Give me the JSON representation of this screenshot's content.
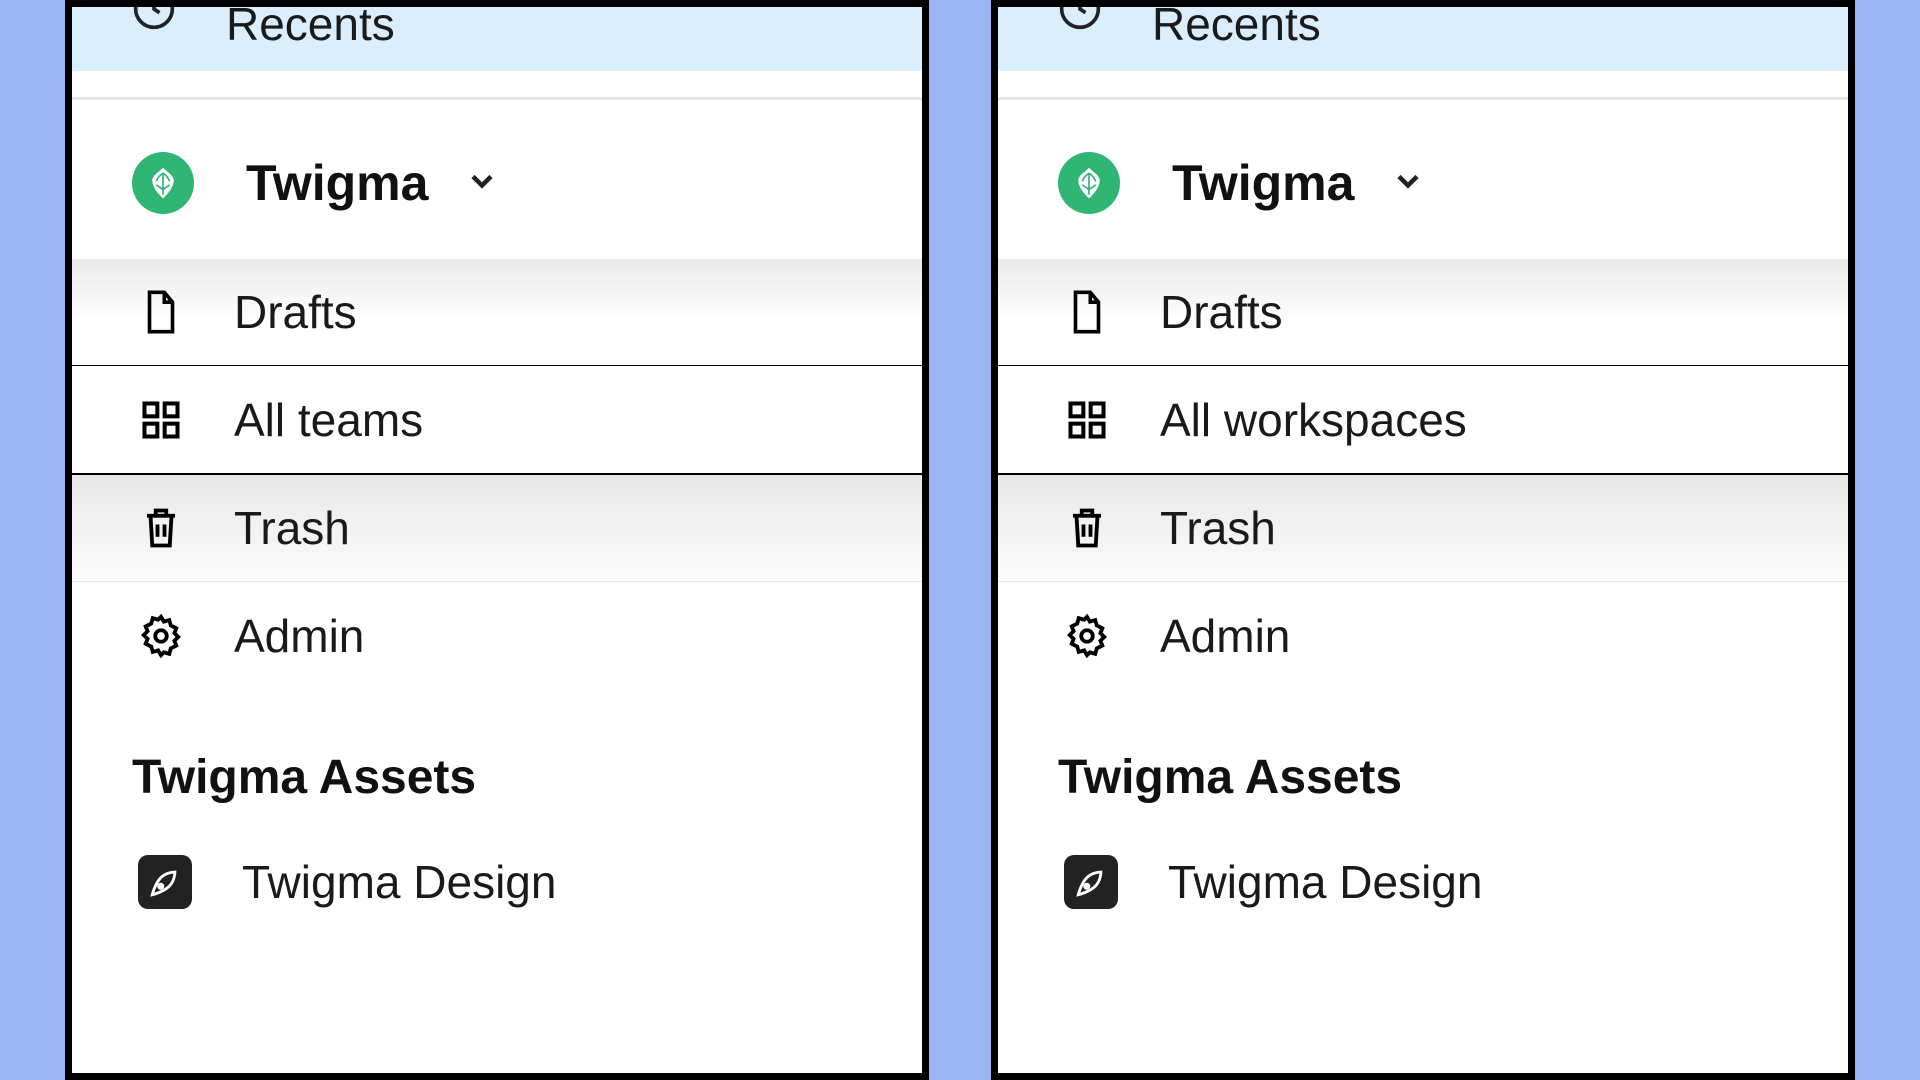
{
  "panels": [
    {
      "recents": "Recents",
      "org": "Twigma",
      "nav": {
        "drafts": "Drafts",
        "all": "All teams",
        "trash": "Trash",
        "admin": "Admin"
      },
      "section": "Twigma Assets",
      "asset": "Twigma Design"
    },
    {
      "recents": "Recents",
      "org": "Twigma",
      "nav": {
        "drafts": "Drafts",
        "all": "All workspaces",
        "trash": "Trash",
        "admin": "Admin"
      },
      "section": "Twigma Assets",
      "asset": "Twigma Design"
    }
  ]
}
